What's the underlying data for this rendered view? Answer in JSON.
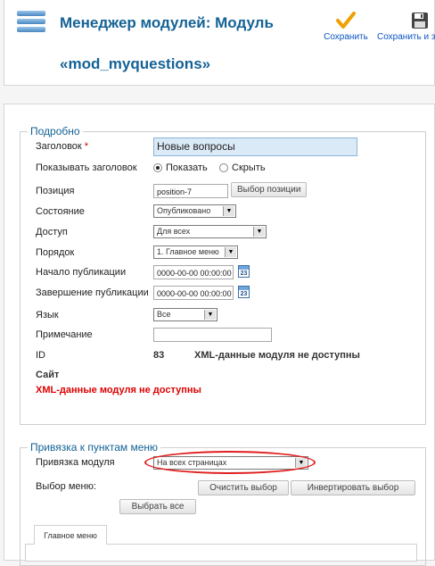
{
  "header": {
    "title_line1": "Менеджер модулей: Модуль",
    "title_line2": "«mod_myquestions»"
  },
  "toolbar": {
    "save_label": "Сохранить",
    "save_close_label": "Сохранить и за"
  },
  "details": {
    "legend": "Подробно",
    "title_label": "Заголовок",
    "required_mark": "*",
    "title_value": "Новые вопросы",
    "show_title_label": "Показывать заголовок",
    "show_option": "Показать",
    "hide_option": "Скрыть",
    "show_title_selected": "show",
    "position_label": "Позиция",
    "position_value": "position-7",
    "position_button": "Выбор позиции",
    "state_label": "Состояние",
    "state_value": "Опубликовано",
    "access_label": "Доступ",
    "access_value": "Для всех",
    "order_label": "Порядок",
    "order_value": "1. Главное меню",
    "publish_up_label": "Начало публикации",
    "publish_up_value": "0000-00-00 00:00:00",
    "publish_down_label": "Завершение публикации",
    "publish_down_value": "0000-00-00 00:00:00",
    "calendar_day": "23",
    "language_label": "Язык",
    "language_value": "Все",
    "note_label": "Примечание",
    "note_value": "",
    "id_label": "ID",
    "id_value": "83",
    "xml_info": "XML-данные модуля не доступны",
    "site_label": "Сайт",
    "xml_error": "XML-данные модуля не доступны"
  },
  "menu_assignment": {
    "legend": "Привязка к пунктам меню",
    "module_assignment_label": "Привязка модуля",
    "module_assignment_value": "На всех страницах",
    "menu_selection_label": "Выбор меню:",
    "clear_button": "Очистить выбор",
    "invert_button": "Инвертировать выбор",
    "select_all_button": "Выбрать все",
    "tabs": [
      "Главное меню"
    ]
  },
  "colors": {
    "title": "#146295",
    "error": "#dd0000",
    "highlight_circle": "#e02020",
    "save_check": "#f0a000"
  }
}
